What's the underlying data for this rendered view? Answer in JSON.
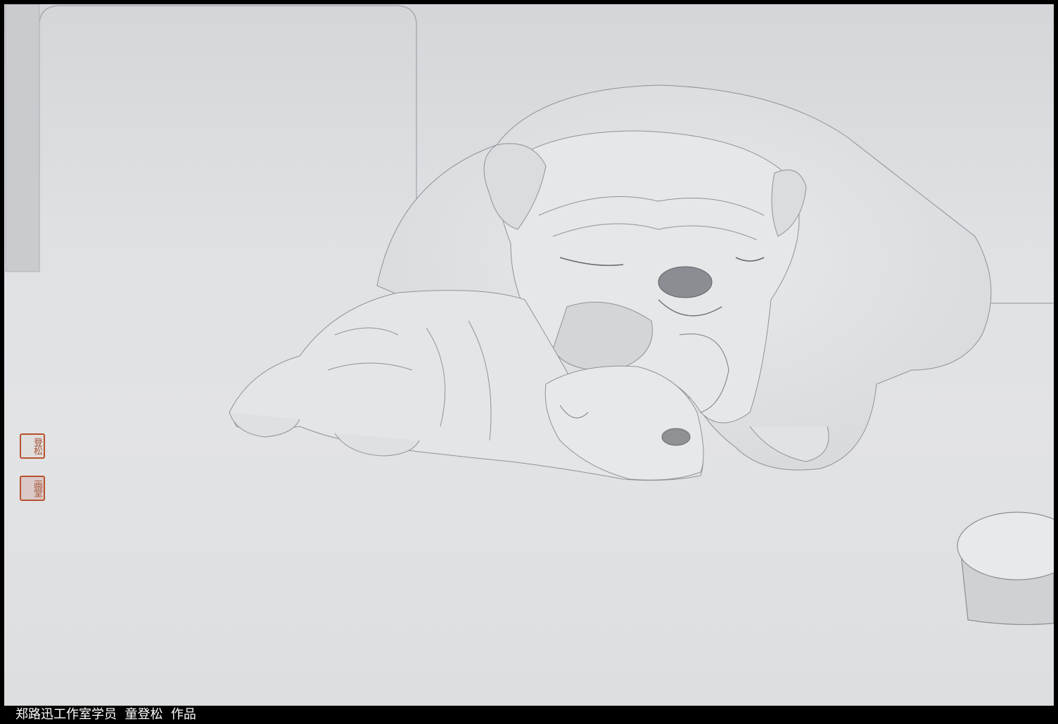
{
  "artwork": {
    "subject": "pencil drawing of two sleeping bulldogs",
    "seals": [
      {
        "text": "登松"
      },
      {
        "text": "画堂"
      }
    ]
  },
  "caption": {
    "text": "郑路迅工作室学员  童登松  作品"
  },
  "colors": {
    "paper": "#dfe1e4",
    "pencil": "#6b6d70",
    "seal": "#b8522f",
    "frame": "#000000",
    "caption_text": "#ffffff"
  }
}
